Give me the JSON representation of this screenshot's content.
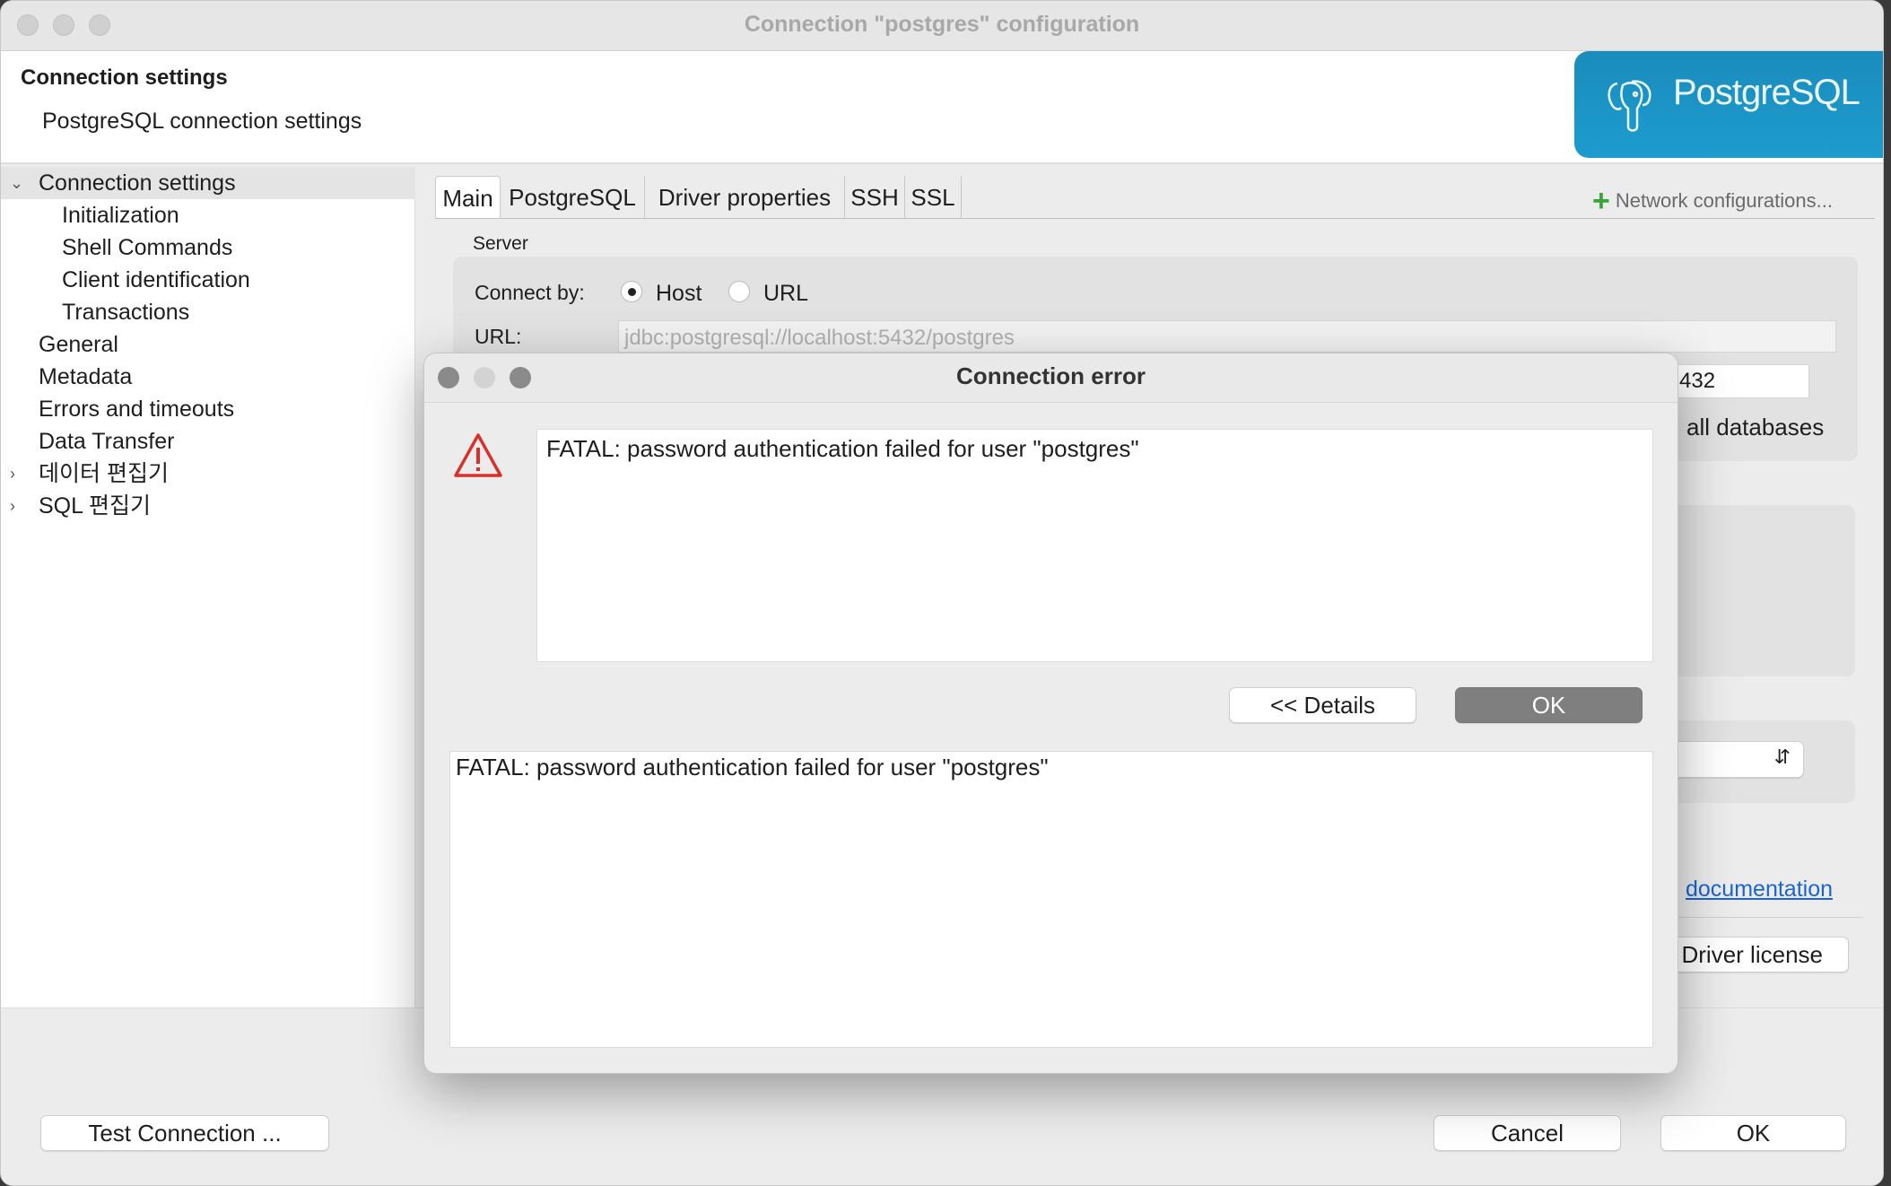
{
  "window": {
    "title": "Connection \"postgres\" configuration"
  },
  "header": {
    "title": "Connection settings",
    "subtitle": "PostgreSQL connection settings",
    "logo_text": "PostgreSQL",
    "logo_color": "#1a93c6"
  },
  "tree": {
    "items": [
      {
        "label": "Connection settings",
        "expanded": true,
        "selected": true
      },
      {
        "label": "Initialization",
        "child": true
      },
      {
        "label": "Shell Commands",
        "child": true
      },
      {
        "label": "Client identification",
        "child": true
      },
      {
        "label": "Transactions",
        "child": true
      },
      {
        "label": "General"
      },
      {
        "label": "Metadata"
      },
      {
        "label": "Errors and timeouts"
      },
      {
        "label": "Data Transfer"
      },
      {
        "label": "데이터 편집기",
        "collapsed": true
      },
      {
        "label": "SQL 편집기",
        "collapsed": true
      }
    ]
  },
  "tabs": [
    {
      "label": "Main",
      "active": true
    },
    {
      "label": "PostgreSQL"
    },
    {
      "label": "Driver properties"
    },
    {
      "label": "SSH"
    },
    {
      "label": "SSL"
    }
  ],
  "network_configurations": "Network configurations...",
  "server": {
    "group_label": "Server",
    "connect_by_label": "Connect by:",
    "options": [
      "Host",
      "URL"
    ],
    "selected": "Host",
    "url_label": "URL:",
    "url_value": "jdbc:postgresql://localhost:5432/postgres",
    "port_partial": "432",
    "all_databases_partial": "all databases"
  },
  "documentation_link": "documentation",
  "driver_license_button": "Driver license",
  "footer": {
    "test_connection": "Test Connection ...",
    "cancel": "Cancel",
    "ok": "OK"
  },
  "dialog": {
    "title": "Connection error",
    "message": "FATAL: password authentication failed for user \"postgres\"",
    "details_button": "<< Details",
    "ok_button": "OK",
    "details_text": "FATAL: password authentication failed for user \"postgres\""
  }
}
